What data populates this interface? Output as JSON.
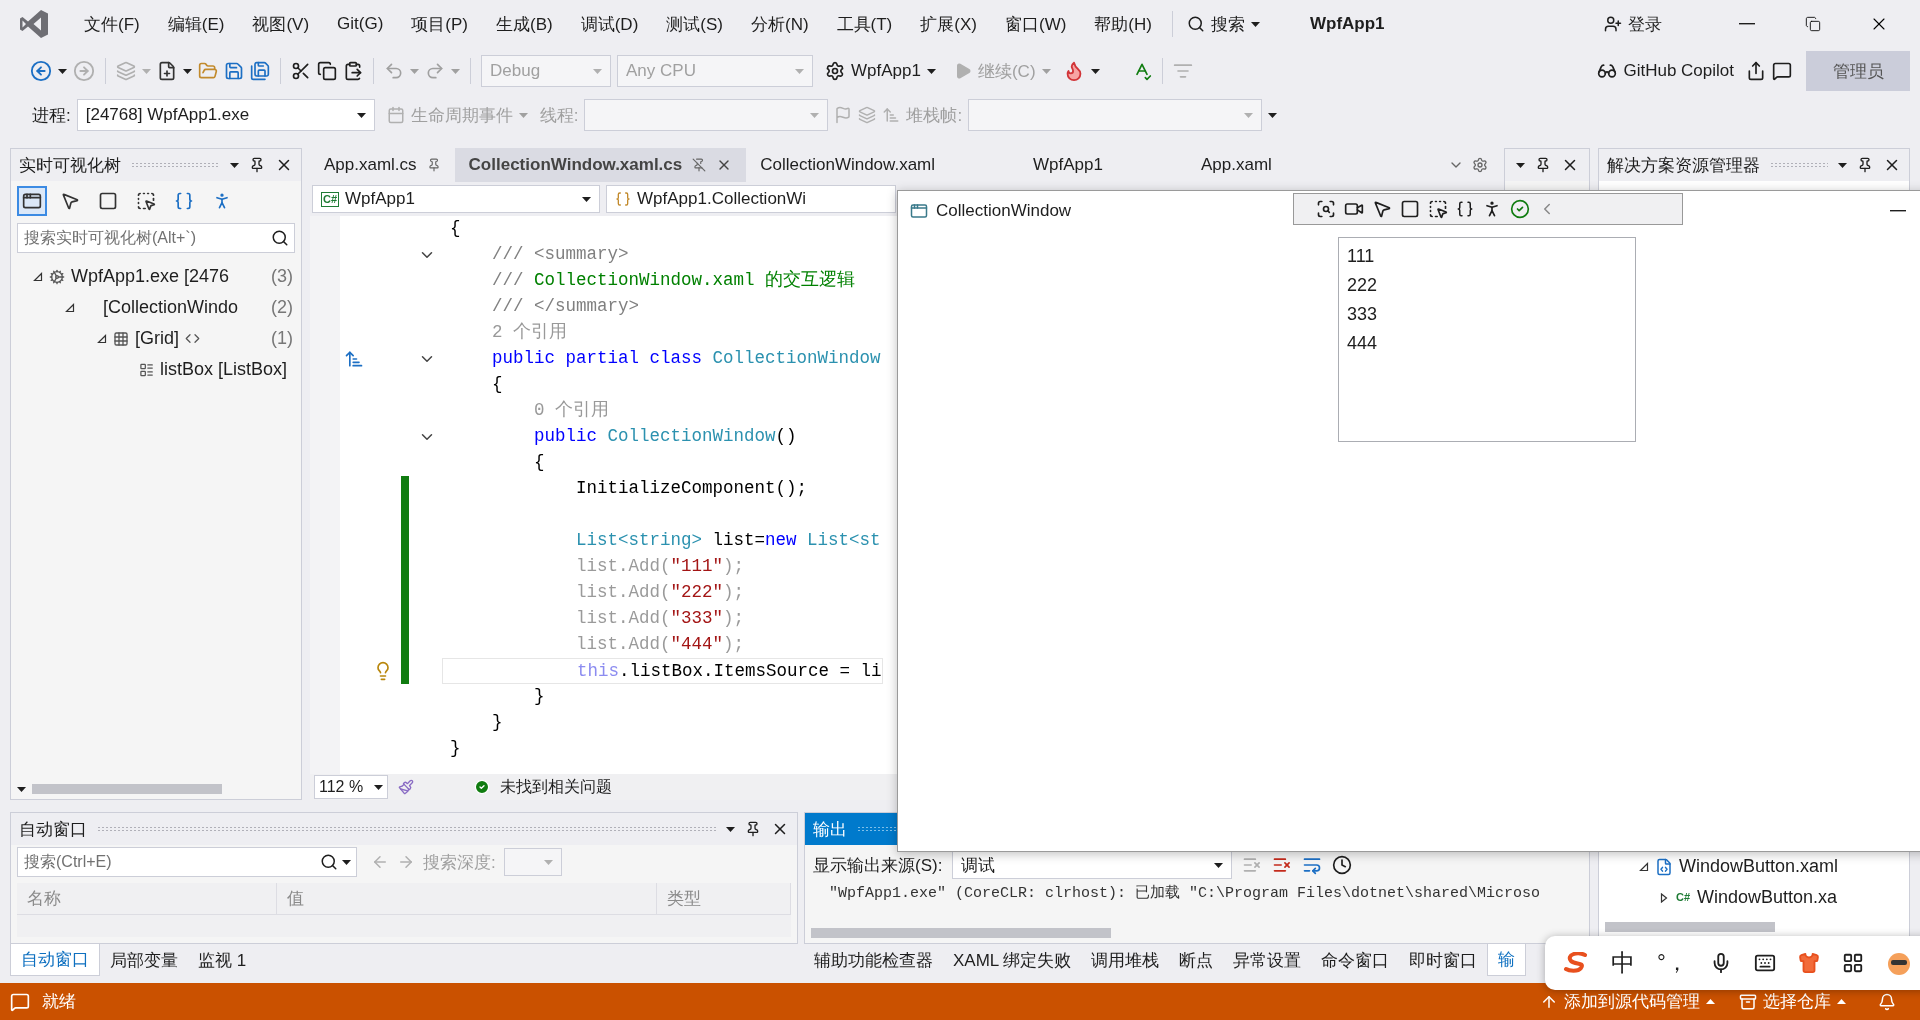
{
  "title_bar": {
    "menu": [
      "文件(F)",
      "编辑(E)",
      "视图(V)",
      "Git(G)",
      "项目(P)",
      "生成(B)",
      "调试(D)",
      "测试(S)",
      "分析(N)",
      "工具(T)",
      "扩展(X)",
      "窗口(W)",
      "帮助(H)"
    ],
    "search": "搜索",
    "title": "WpfApp1",
    "sign_in": "登录"
  },
  "toolbar": {
    "configuration": "Debug",
    "platform": "Any CPU",
    "start": "WpfApp1",
    "continue": "继续(C)",
    "copilot": "GitHub Copilot",
    "admin": "管理员"
  },
  "debug_location": {
    "process_label": "进程:",
    "process": "[24768] WpfApp1.exe",
    "lifecycle": "生命周期事件",
    "thread_label": "线程:",
    "stack_label": "堆栈帧:"
  },
  "live_tree": {
    "title": "实时可视化树",
    "search_placeholder": "搜索实时可视化树(Alt+`)",
    "tools": [
      {
        "kind": "window",
        "selected": true
      },
      {
        "kind": "pointer",
        "selected": false
      },
      {
        "kind": "frame",
        "selected": false
      },
      {
        "kind": "select",
        "selected": false
      },
      {
        "kind": "binding",
        "selected": false
      },
      {
        "kind": "accessibility",
        "selected": false
      }
    ],
    "nodes": [
      {
        "label": "WpfApp1.exe [2476",
        "count": "(3)",
        "kind": "process",
        "expanded": true,
        "children": [
          {
            "label": "[CollectionWindo",
            "count": "(2)",
            "expanded": true,
            "children": [
              {
                "label": "[Grid]",
                "count": "(1)",
                "kind": "grid",
                "expanded": true,
                "children": [
                  {
                    "label": "listBox [ListBox]",
                    "kind": "listbox"
                  }
                ]
              }
            ]
          }
        ]
      }
    ]
  },
  "editor": {
    "tabs": [
      {
        "label": "App.xaml.cs",
        "selected": false,
        "pinned": true
      },
      {
        "label": "CollectionWindow.xaml.cs",
        "selected": true,
        "pinned": false
      },
      {
        "label": "CollectionWindow.xaml",
        "selected": false,
        "pinned": false
      },
      {
        "label": "WpfApp1",
        "selected": false,
        "pinned": false
      },
      {
        "label": "App.xaml",
        "selected": false,
        "pinned": false
      }
    ],
    "project_badge": "C#",
    "project": "WpfApp1",
    "member": "WpfApp1.CollectionWi",
    "lines": [
      {
        "segments": [
          {
            "text": "{",
            "kind": "plain"
          }
        ]
      },
      {
        "segments": [
          {
            "text": "    /// <summary>",
            "kind": "doc"
          }
        ],
        "fold": true
      },
      {
        "segments": [
          {
            "text": "    /// ",
            "kind": "doc"
          },
          {
            "text": "CollectionWindow.xaml 的交互逻辑",
            "kind": "comment"
          }
        ]
      },
      {
        "segments": [
          {
            "text": "    /// </summary>",
            "kind": "doc"
          }
        ]
      },
      {
        "segments": [
          {
            "text": "    2 个引用",
            "kind": "lens"
          }
        ]
      },
      {
        "segments": [
          {
            "text": "    public partial class ",
            "kind": "keyword"
          },
          {
            "text": "CollectionWindow",
            "kind": "type"
          }
        ],
        "fold": true,
        "glyph": true
      },
      {
        "segments": [
          {
            "text": "    {",
            "kind": "plain"
          }
        ]
      },
      {
        "segments": [
          {
            "text": "        0 个引用",
            "kind": "lens"
          }
        ]
      },
      {
        "segments": [
          {
            "text": "        public ",
            "kind": "keyword"
          },
          {
            "text": "CollectionWindow",
            "kind": "type"
          },
          {
            "text": "()",
            "kind": "plain"
          }
        ],
        "fold": true
      },
      {
        "segments": [
          {
            "text": "        {",
            "kind": "plain"
          }
        ]
      },
      {
        "segments": [
          {
            "text": "            InitializeComponent();",
            "kind": "plain"
          }
        ],
        "changed": true
      },
      {
        "changed": true
      },
      {
        "segments": [
          {
            "text": "            List<string>",
            "kind": "type"
          },
          {
            "text": " list=",
            "kind": "plain"
          },
          {
            "text": "new",
            "kind": "keyword"
          },
          {
            "text": " List<st",
            "kind": "type"
          }
        ],
        "changed": true
      },
      {
        "segments": [
          {
            "text": "            list.Add(",
            "kind": "faded"
          },
          {
            "text": "\"111\"",
            "kind": "string"
          },
          {
            "text": ");",
            "kind": "faded"
          }
        ],
        "changed": true
      },
      {
        "segments": [
          {
            "text": "            list.Add(",
            "kind": "faded"
          },
          {
            "text": "\"222\"",
            "kind": "string"
          },
          {
            "text": ");",
            "kind": "faded"
          }
        ],
        "changed": true
      },
      {
        "segments": [
          {
            "text": "            list.Add(",
            "kind": "faded"
          },
          {
            "text": "\"333\"",
            "kind": "string"
          },
          {
            "text": ");",
            "kind": "faded"
          }
        ],
        "changed": true
      },
      {
        "segments": [
          {
            "text": "            list.Add(",
            "kind": "faded"
          },
          {
            "text": "\"444\"",
            "kind": "string"
          },
          {
            "text": ");",
            "kind": "faded"
          }
        ],
        "changed": true
      },
      {
        "segments": [
          {
            "text": "            this",
            "kind": "faded-keyword"
          },
          {
            "text": ".listBox.ItemsSource = li",
            "kind": "plain"
          }
        ],
        "changed": true,
        "bulb": true,
        "current": true
      },
      {
        "segments": [
          {
            "text": "        }",
            "kind": "plain"
          }
        ]
      },
      {
        "segments": [
          {
            "text": "    }",
            "kind": "plain"
          }
        ]
      },
      {
        "segments": [
          {
            "text": "}",
            "kind": "plain"
          }
        ]
      }
    ],
    "zoom": "112 %",
    "issues": "未找到相关问题"
  },
  "solution_explorer": {
    "title": "解决方案资源管理器",
    "items": [
      {
        "label": "WindowButton.xaml",
        "kind": "xaml",
        "expanded": true
      },
      {
        "label": "WindowButton.xa",
        "kind": "csharp",
        "badge": "C#",
        "expanded": false
      }
    ]
  },
  "autos": {
    "title": "自动窗口",
    "search_placeholder": "搜索(Ctrl+E)",
    "depth_label": "搜索深度:",
    "columns": [
      "名称",
      "值",
      "类型"
    ],
    "tabs": [
      {
        "label": "自动窗口",
        "selected": true
      },
      {
        "label": "局部变量",
        "selected": false
      },
      {
        "label": "监视 1",
        "selected": false
      }
    ]
  },
  "output": {
    "title": "输出",
    "source_label": "显示输出来源(S):",
    "source": "调试",
    "lines": [
      "\"WpfApp1.exe\" (CoreCLR: clrhost): 已加载 \"C:\\Program Files\\dotnet\\shared\\Microso"
    ],
    "tabs": [
      {
        "label": "辅助功能检查器",
        "selected": false
      },
      {
        "label": "XAML 绑定失败",
        "selected": false
      },
      {
        "label": "调用堆栈",
        "selected": false
      },
      {
        "label": "断点",
        "selected": false
      },
      {
        "label": "异常设置",
        "selected": false
      },
      {
        "label": "命令窗口",
        "selected": false
      },
      {
        "label": "即时窗口",
        "selected": false
      },
      {
        "label": "输",
        "selected": true
      }
    ]
  },
  "status_bar": {
    "message": "就绪",
    "source_control": "添加到源代码管理",
    "repository": "选择仓库"
  },
  "app_window": {
    "title": "CollectionWindow",
    "items": [
      "111",
      "222",
      "333",
      "444"
    ]
  },
  "ime_bar": {
    "mode": "中",
    "punctuation": "°，"
  }
}
